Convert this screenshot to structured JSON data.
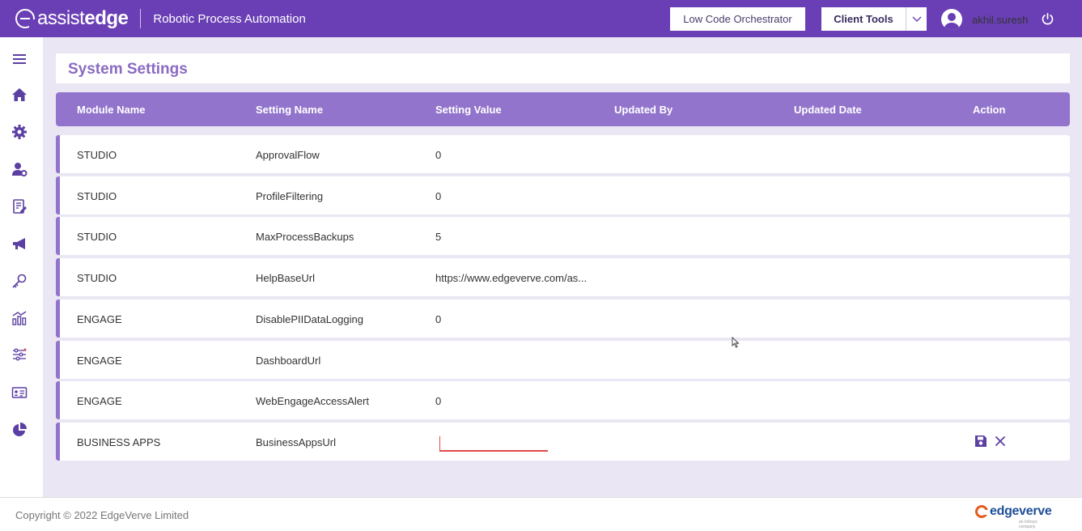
{
  "header": {
    "logo_light": "assist",
    "logo_bold": "edge",
    "app_title": "Robotic Process Automation",
    "low_code_label": "Low Code Orchestrator",
    "client_tools_label": "Client Tools",
    "username": "akhil.suresh"
  },
  "colors": {
    "brand_purple": "#6a3fb5",
    "table_header": "#9274cc",
    "title_text": "#8a6ac2",
    "error_underline": "#e24a4a",
    "background": "#ebe6f4"
  },
  "sidebar": {
    "items": [
      {
        "icon": "menu-icon"
      },
      {
        "icon": "home-icon"
      },
      {
        "icon": "gear-icon"
      },
      {
        "icon": "user-settings-icon"
      },
      {
        "icon": "document-edit-icon"
      },
      {
        "icon": "megaphone-icon"
      },
      {
        "icon": "key-icon"
      },
      {
        "icon": "analytics-icon"
      },
      {
        "icon": "sliders-icon"
      },
      {
        "icon": "id-card-icon"
      },
      {
        "icon": "pie-chart-icon"
      }
    ]
  },
  "page": {
    "title": "System Settings"
  },
  "table": {
    "columns": [
      "Module Name",
      "Setting Name",
      "Setting Value",
      "Updated By",
      "Updated Date",
      "Action"
    ],
    "rows": [
      {
        "module": "STUDIO",
        "setting": "ApprovalFlow",
        "value": "0",
        "updated_by": "",
        "updated_date": ""
      },
      {
        "module": "STUDIO",
        "setting": "ProfileFiltering",
        "value": "0",
        "updated_by": "",
        "updated_date": ""
      },
      {
        "module": "STUDIO",
        "setting": "MaxProcessBackups",
        "value": "5",
        "updated_by": "",
        "updated_date": ""
      },
      {
        "module": "STUDIO",
        "setting": "HelpBaseUrl",
        "value": "https://www.edgeverve.com/as...",
        "updated_by": "",
        "updated_date": ""
      },
      {
        "module": "ENGAGE",
        "setting": "DisablePIIDataLogging",
        "value": "0",
        "updated_by": "",
        "updated_date": ""
      },
      {
        "module": "ENGAGE",
        "setting": "DashboardUrl",
        "value": "",
        "updated_by": "",
        "updated_date": ""
      },
      {
        "module": "ENGAGE",
        "setting": "WebEngageAccessAlert",
        "value": "0",
        "updated_by": "",
        "updated_date": ""
      },
      {
        "module": "BUSINESS APPS",
        "setting": "BusinessAppsUrl",
        "value": "",
        "updated_by": "",
        "updated_date": "",
        "editing": true
      }
    ]
  },
  "footer": {
    "copyright": "Copyright © 2022 EdgeVerve Limited",
    "brand": "edgeverve",
    "brand_sub": "an Infosys company"
  }
}
